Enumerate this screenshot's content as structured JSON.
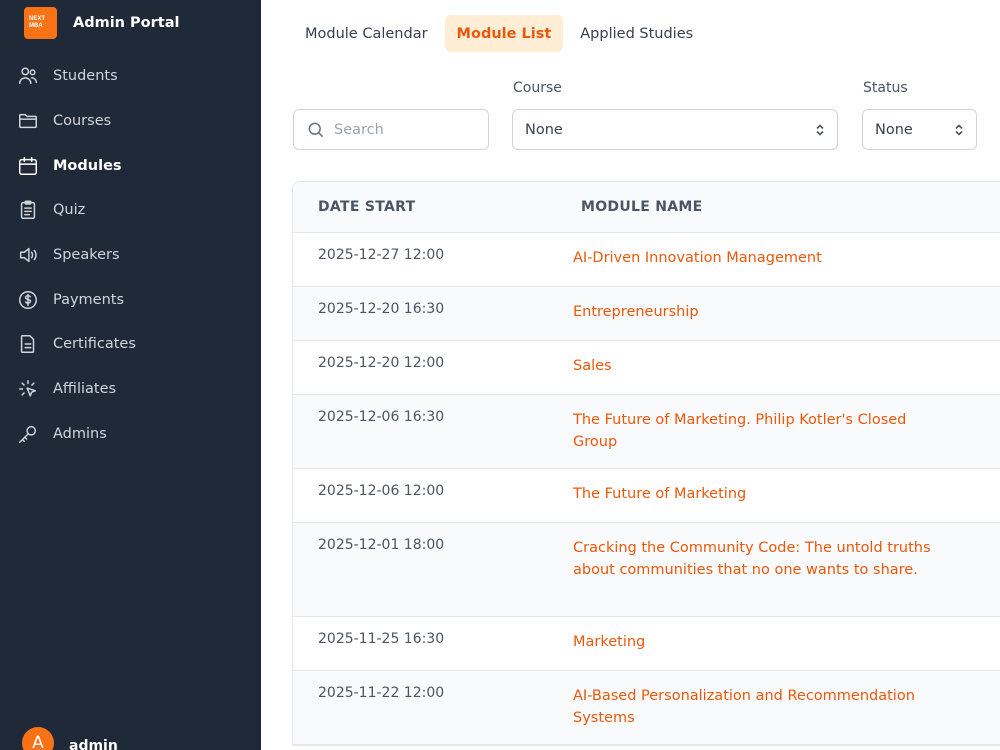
{
  "sidebar": {
    "logo_text_line1": "NEXT",
    "logo_text_line2": "MBA",
    "title": "Admin Portal",
    "items": [
      {
        "label": "Students"
      },
      {
        "label": "Courses"
      },
      {
        "label": "Modules"
      },
      {
        "label": "Quiz"
      },
      {
        "label": "Speakers"
      },
      {
        "label": "Payments"
      },
      {
        "label": "Certificates"
      },
      {
        "label": "Affiliates"
      },
      {
        "label": "Admins"
      }
    ],
    "active_item": "Modules",
    "user": {
      "initial": "A",
      "name": "admin"
    }
  },
  "tabs": [
    {
      "label": "Module Calendar"
    },
    {
      "label": "Module List"
    },
    {
      "label": "Applied Studies"
    }
  ],
  "active_tab": "Module List",
  "filters": {
    "search_placeholder": "Search",
    "course_label": "Course",
    "course_value": "None",
    "status_label": "Status",
    "status_value": "None"
  },
  "table": {
    "headers": [
      "DATE START",
      "MODULE NAME"
    ],
    "rows": [
      {
        "date": "2025-12-27 12:00",
        "name": "AI-Driven Innovation Management"
      },
      {
        "date": "2025-12-20 16:30",
        "name": "Entrepreneurship"
      },
      {
        "date": "2025-12-20 12:00",
        "name": "Sales"
      },
      {
        "date": "2025-12-06 16:30",
        "name": "The Future of Marketing. Philip Kotler's Closed Group"
      },
      {
        "date": "2025-12-06 12:00",
        "name": "The Future of Marketing"
      },
      {
        "date": "2025-12-01 18:00",
        "name": "Cracking the Community Code: The untold truths about communities that no one wants to share."
      },
      {
        "date": "2025-11-25 16:30",
        "name": "Marketing"
      },
      {
        "date": "2025-11-22 12:00",
        "name": "AI-Based Personalization and Recommendation Systems"
      }
    ]
  },
  "colors": {
    "sidebar_bg": "#1f2937",
    "accent": "#ea580c",
    "active_tab_bg": "#ffedd5"
  }
}
